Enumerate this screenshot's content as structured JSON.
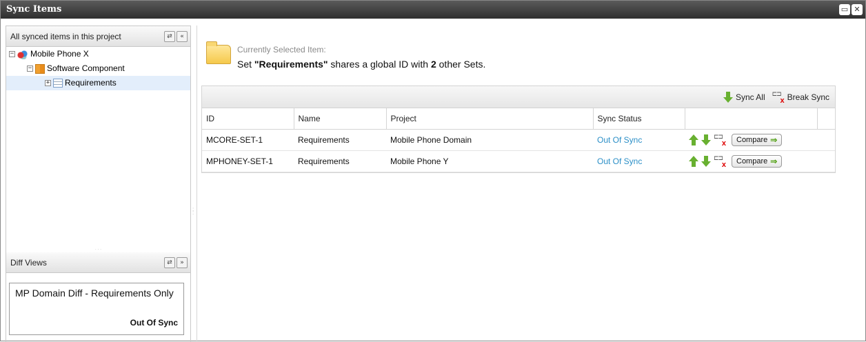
{
  "window": {
    "title": "Sync Items"
  },
  "left_panel": {
    "header": "All synced items in this project",
    "tree": [
      {
        "label": "Mobile Phone X",
        "expander": "−",
        "icon": "project-icon"
      },
      {
        "label": "Software Component",
        "expander": "−",
        "icon": "component-icon"
      },
      {
        "label": "Requirements",
        "expander": "+",
        "icon": "requirements-set-icon",
        "selected": true
      }
    ]
  },
  "diff_views": {
    "header": "Diff Views",
    "item": {
      "title": "MP Domain Diff - Requirements Only",
      "status": "Out Of Sync"
    }
  },
  "selection": {
    "label": "Currently Selected Item:",
    "prefix": "Set ",
    "set_name": "\"Requirements\"",
    "middle": " shares a global ID with ",
    "count": "2",
    "suffix": " other Sets."
  },
  "toolbar": {
    "sync_all": "Sync All",
    "break_sync": "Break Sync"
  },
  "table": {
    "columns": [
      "ID",
      "Name",
      "Project",
      "Sync Status"
    ],
    "rows": [
      {
        "id": "MCORE-SET-1",
        "name": "Requirements",
        "project": "Mobile Phone Domain",
        "status": "Out Of Sync",
        "compare": "Compare"
      },
      {
        "id": "MPHONEY-SET-1",
        "name": "Requirements",
        "project": "Mobile Phone Y",
        "status": "Out Of Sync",
        "compare": "Compare"
      }
    ]
  },
  "colors": {
    "titlebar": "#3a3a3a",
    "status": "#2b8fc7",
    "sync_arrow": "#68b030",
    "selected_row": "#e3eefb"
  }
}
